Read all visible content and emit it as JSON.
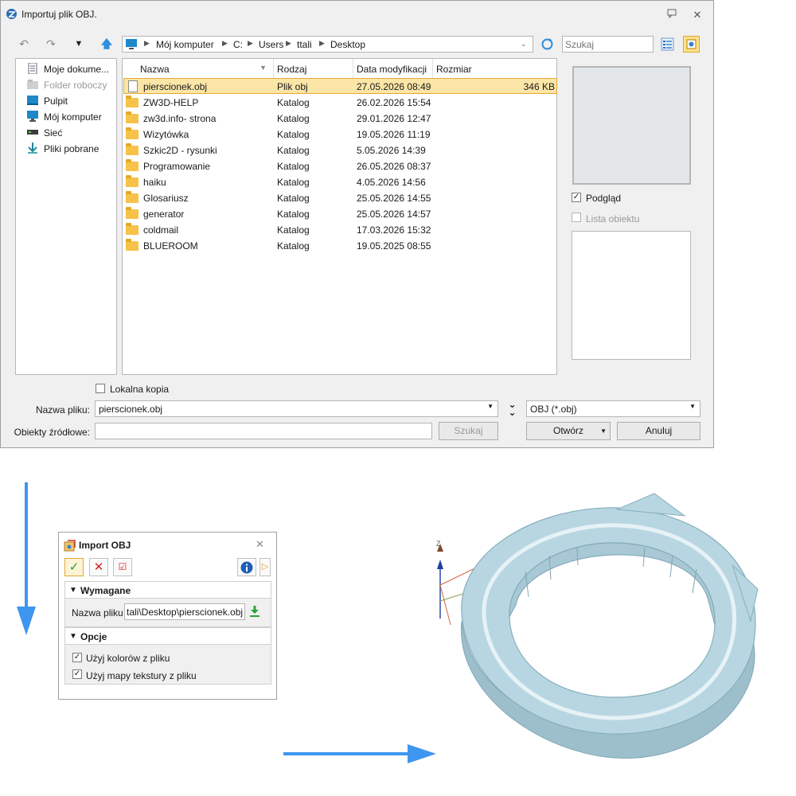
{
  "dialog": {
    "title": "Importuj plik OBJ.",
    "address": [
      "Mój komputer",
      "C:",
      "Users",
      "ttali",
      "Desktop"
    ],
    "search_placeholder": "Szukaj",
    "places": [
      {
        "label": "Moje dokume...",
        "icon": "documents-icon",
        "disabled": false
      },
      {
        "label": "Folder roboczy",
        "icon": "work-folder-icon",
        "disabled": true
      },
      {
        "label": "Pulpit",
        "icon": "desktop-icon",
        "disabled": false
      },
      {
        "label": "Mój komputer",
        "icon": "computer-icon",
        "disabled": false
      },
      {
        "label": "Sieć",
        "icon": "network-icon",
        "disabled": false
      },
      {
        "label": "Pliki pobrane",
        "icon": "downloads-icon",
        "disabled": false
      }
    ],
    "columns": [
      "Nazwa",
      "Rodzaj",
      "Data modyfikacji",
      "Rozmiar"
    ],
    "files": [
      {
        "name": "pierscionek.obj",
        "type": "Plik obj",
        "date": "27.05.2026 08:49",
        "size": "346 KB",
        "selected": true,
        "icon": "file-icon"
      },
      {
        "name": "ZW3D-HELP",
        "type": "Katalog",
        "date": "26.02.2026 15:54",
        "size": "",
        "icon": "folder-icon"
      },
      {
        "name": "zw3d.info- strona",
        "type": "Katalog",
        "date": "29.01.2026 12:47",
        "size": "",
        "icon": "folder-icon"
      },
      {
        "name": "Wizytówka",
        "type": "Katalog",
        "date": "19.05.2026 11:19",
        "size": "",
        "icon": "folder-icon"
      },
      {
        "name": "Szkic2D - rysunki",
        "type": "Katalog",
        "date": "5.05.2026 14:39",
        "size": "",
        "icon": "folder-icon"
      },
      {
        "name": "Programowanie",
        "type": "Katalog",
        "date": "26.05.2026 08:37",
        "size": "",
        "icon": "folder-icon"
      },
      {
        "name": "haiku",
        "type": "Katalog",
        "date": "4.05.2026 14:56",
        "size": "",
        "icon": "folder-icon"
      },
      {
        "name": "Glosariusz",
        "type": "Katalog",
        "date": "25.05.2026 14:55",
        "size": "",
        "icon": "folder-icon"
      },
      {
        "name": "generator",
        "type": "Katalog",
        "date": "25.05.2026 14:57",
        "size": "",
        "icon": "folder-icon"
      },
      {
        "name": "coldmail",
        "type": "Katalog",
        "date": "17.03.2026 15:32",
        "size": "",
        "icon": "folder-icon"
      },
      {
        "name": "BLUEROOM",
        "type": "Katalog",
        "date": "19.05.2025 08:55",
        "size": "",
        "icon": "folder-icon"
      }
    ],
    "preview_label": "Podgląd",
    "preview_checked": true,
    "object_list_label": "Lista obiektu",
    "object_list_checked": false,
    "local_copy_label": "Lokalna kopia",
    "local_copy_checked": false,
    "filename_label": "Nazwa pliku:",
    "filename_value": "pierscionek.obj",
    "filetype_value": "OBJ (*.obj)",
    "source_objects_label": "Obiekty źródłowe:",
    "source_objects_value": "",
    "search_button": "Szukaj",
    "open_button": "Otwórz",
    "cancel_button": "Anuluj"
  },
  "panel": {
    "title": "Import OBJ",
    "required_section": "Wymagane",
    "filename_label": "Nazwa pliku",
    "filename_value": "tali\\Desktop\\pierscionek.obj",
    "options_section": "Opcje",
    "option_colors_label": "Użyj kolorów z pliku",
    "option_colors_checked": true,
    "option_texture_label": "Użyj mapy tekstury z pliku",
    "option_texture_checked": true
  },
  "viewport": {
    "axis_z_label": "Z",
    "model_color": "#a8cad6"
  },
  "colors": {
    "accent_arrow": "#3e96ef",
    "selection_fill": "#fbe6a7",
    "selection_border": "#e5a830"
  }
}
